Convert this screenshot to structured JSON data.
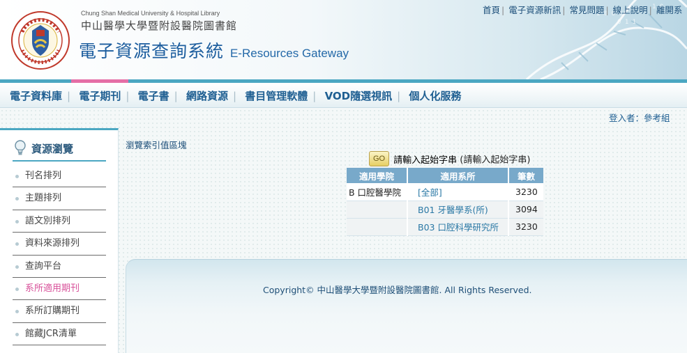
{
  "header": {
    "library_name_en": "Chung Shan Medical University & Hospital Library",
    "library_name_zh": "中山醫學大學暨附設醫院圖書館",
    "system_title_zh": "電子資源查詢系統",
    "system_title_en": "E-Resources Gateway",
    "top_links": [
      "首頁",
      "電子資源新訊",
      "常見問題",
      "線上說明",
      "離開系"
    ]
  },
  "nav": {
    "items": [
      "電子資料庫",
      "電子期刊",
      "電子書",
      "網路資源",
      "書目管理軟體",
      "VOD隨選視訊",
      "個人化服務"
    ],
    "active": "電子期刊"
  },
  "login": {
    "text": "登入者：參考組"
  },
  "sidebar": {
    "title": "資源瀏覽",
    "items": [
      "刊名排列",
      "主題排列",
      "語文別排列",
      "資料來源排列",
      "查詢平台",
      "系所適用期刊",
      "系所訂購期刊",
      "館藏JCR清單"
    ],
    "active": "系所適用期刊"
  },
  "main": {
    "breadcrumb": "瀏覽索引值區塊",
    "go_button": "GO",
    "start_input_label": "請輸入起始字串",
    "start_hint": "(請輸入起始字串)",
    "table": {
      "headers": [
        "適用學院",
        "適用系所",
        "筆數"
      ],
      "rows": [
        {
          "school": "B 口腔醫學院",
          "dept": "[全部]",
          "count": "3230"
        },
        {
          "school": "",
          "dept": "B01 牙醫學系(所)",
          "count": "3094"
        },
        {
          "school": "",
          "dept": "B03 口腔科學研究所",
          "count": "3230"
        }
      ]
    }
  },
  "footer": {
    "copyright": "Copyright© 中山醫學大學暨附設醫院圖書館. All Rights Reserved."
  },
  "colors": {
    "accent_blue": "#4ba7c2",
    "active_pink": "#e56ea6",
    "table_header": "#78a9ca"
  }
}
